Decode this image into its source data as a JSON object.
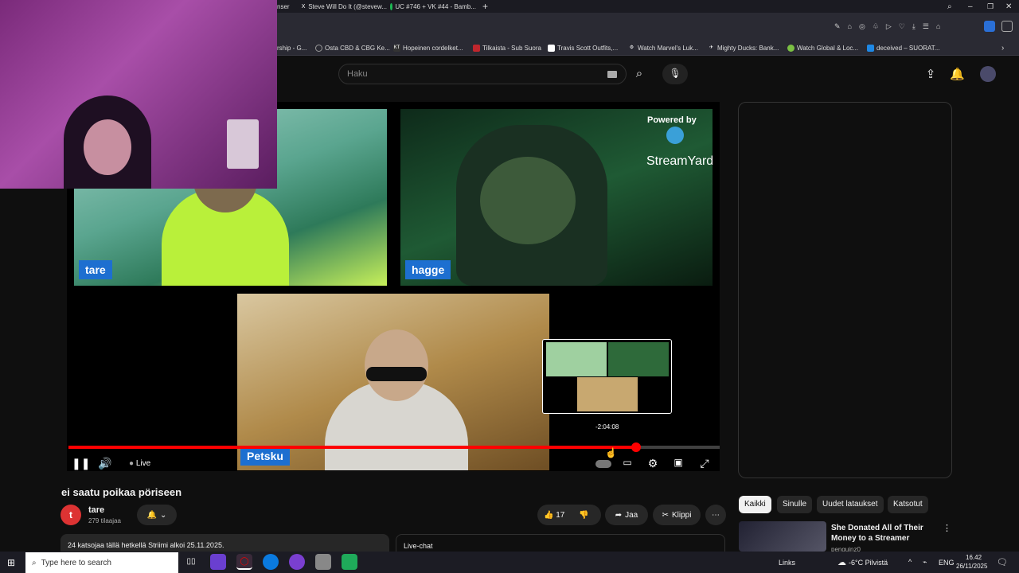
{
  "browser": {
    "tabs": [
      {
        "label": "nser",
        "icon": ""
      },
      {
        "label": "Steve Will Do It (@stevew...",
        "icon": "X"
      },
      {
        "label": "UC #746 + VK #44 - Bamb...",
        "icon": ""
      }
    ],
    "new_tab": "+",
    "bookmarks": [
      {
        "label": "rship - G...",
        "icon": ""
      },
      {
        "label": "Osta CBD & CBG Ke...",
        "icon": ""
      },
      {
        "label": "Hopeinen cordelket...",
        "icon": "KT"
      },
      {
        "label": "Tilkaista - Sub Suora",
        "icon": ""
      },
      {
        "label": "Travis Scott Outfits,...",
        "icon": ""
      },
      {
        "label": "Watch Marvel's Luk...",
        "icon": ""
      },
      {
        "label": "Mighty Ducks: Bank...",
        "icon": ""
      },
      {
        "label": "Watch Global & Loc...",
        "icon": ""
      },
      {
        "label": "deceived – SUORAT...",
        "icon": ""
      }
    ]
  },
  "youtube": {
    "search_placeholder": "Haku",
    "video": {
      "watermark_line1": "Powered by",
      "watermark_line2": "StreamYard",
      "participants": [
        "tare",
        "hagge",
        "Petsku"
      ],
      "preview_time": "-2:04:08",
      "live_label": "Live",
      "progress_fraction": 0.872
    },
    "title": "ei saatu poikaa pöriseen",
    "channel": {
      "avatar_letter": "t",
      "name": "tare",
      "subscribers": "279 tilaajaa"
    },
    "actions": {
      "likes": "17",
      "share": "Jaa",
      "clip": "Klippi"
    },
    "description": "24 katsojaa tällä hetkellä  Striimi alkoi 25.11.2025.",
    "live_chat_label": "Live-chat",
    "chips": [
      "Kaikki",
      "Sinulle",
      "Uudet lataukset",
      "Katsotut"
    ],
    "recommended": {
      "title": "She Donated All of Their Money to a Streamer",
      "channel": "penguinz0"
    }
  },
  "taskbar": {
    "search_placeholder": "Type here to search",
    "links_label": "Links",
    "weather": "-6°C  Pilvistä",
    "lang": "ENG",
    "time": "16.42",
    "date": "26/11/2025"
  },
  "colors": {
    "accent_red": "#ff0000",
    "nametag_blue": "#1d6fd0",
    "background": "#0f0f0f"
  }
}
